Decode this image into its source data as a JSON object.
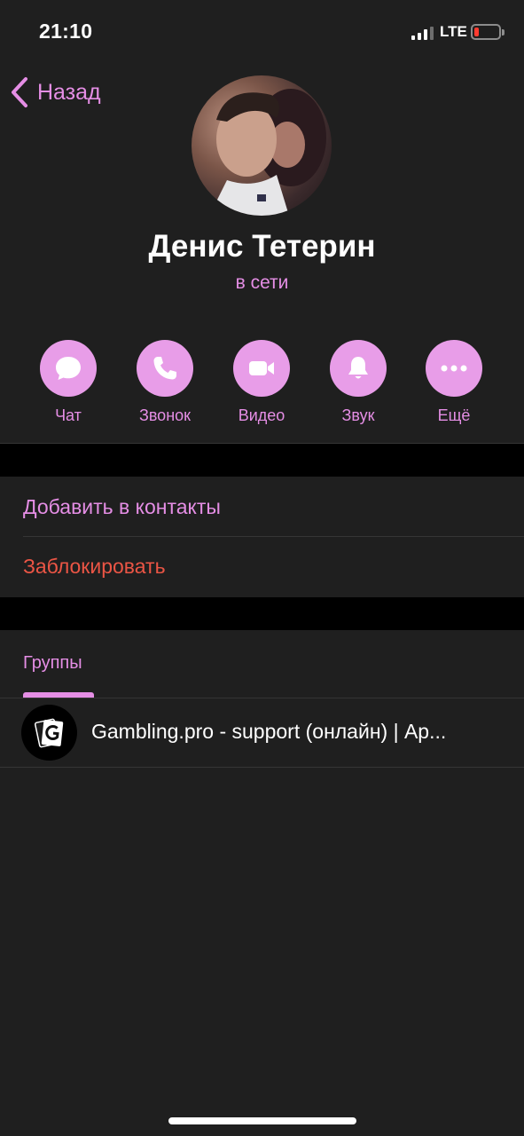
{
  "status_bar": {
    "time": "21:10",
    "network": "LTE"
  },
  "nav": {
    "back_label": "Назад"
  },
  "profile": {
    "name": "Денис Тетерин",
    "status": "в сети"
  },
  "actions": [
    {
      "label": "Чат",
      "icon": "chat-bubble-icon"
    },
    {
      "label": "Звонок",
      "icon": "phone-icon"
    },
    {
      "label": "Видео",
      "icon": "video-camera-icon"
    },
    {
      "label": "Звук",
      "icon": "bell-icon"
    },
    {
      "label": "Ещё",
      "icon": "more-dots-icon"
    }
  ],
  "options": {
    "add_contact": "Добавить в контакты",
    "block": "Заблокировать"
  },
  "tabs": {
    "groups": "Группы"
  },
  "groups": [
    {
      "title": "Gambling.pro - support (онлайн) | Ар..."
    }
  ],
  "colors": {
    "background": "#1f1f1f",
    "accent": "#e58ee5",
    "action_circle": "#e89de8",
    "danger": "#eb5545",
    "section_gap": "#000000",
    "battery_low": "#ff3b30"
  }
}
